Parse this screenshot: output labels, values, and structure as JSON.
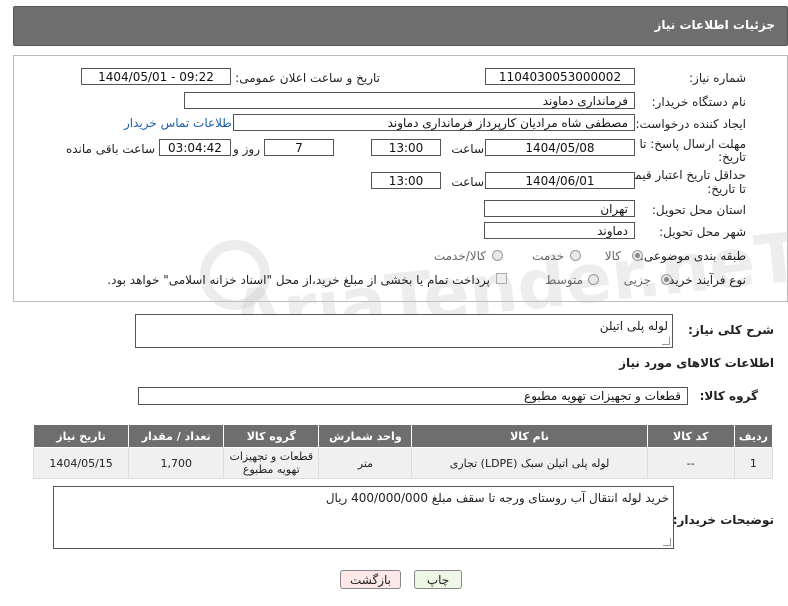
{
  "header": {
    "title": "جزئیات اطلاعات نیاز"
  },
  "form": {
    "need_number_label": "شماره نیاز:",
    "need_number": "1104030053000002",
    "announce_label": "تاریخ و ساعت اعلان عمومی:",
    "announce_value": "1404/05/01 - 09:22",
    "buyer_org_label": "نام دستگاه خریدار:",
    "buyer_org": "فرمانداری دماوند",
    "creator_label": "ایجاد کننده درخواست:",
    "creator": "مصطفی شاه مرادیان کارپرداز فرمانداری دماوند",
    "contact_link": "اطلاعات تماس خریدار",
    "deadline_label_1": "مهلت ارسال پاسخ: تا",
    "deadline_label_2": "تاریخ:",
    "deadline_date": "1404/05/08",
    "time_label": "ساعت",
    "deadline_time": "13:00",
    "days_value": "7",
    "days_label": "روز و",
    "remaining_time": "03:04:42",
    "remaining_label": "ساعت باقی مانده",
    "validity_label_1": "حداقل تاریخ اعتبار قیمت:",
    "validity_label_2": "تا تاریخ:",
    "validity_date": "1404/06/01",
    "validity_time": "13:00",
    "province_label": "استان محل تحویل:",
    "province": "تهران",
    "city_label": "شهر محل تحویل:",
    "city": "دماوند",
    "category_label": "طبقه بندی موضوعی:",
    "category_options": [
      "کالا",
      "خدمت",
      "کالا/خدمت"
    ],
    "category_selected": "کالا",
    "process_label": "نوع فرآیند خرید :",
    "process_options": [
      "جزیی",
      "متوسط"
    ],
    "process_selected": "جزیی",
    "payment_note": "پرداخت تمام یا بخشی از مبلغ خرید،از محل \"اسناد خزانه اسلامی\" خواهد بود."
  },
  "description": {
    "label": "شرح کلی نیاز:",
    "value": "لوله پلی اتیلن"
  },
  "goods_info_title": "اطلاعات کالاهای مورد نیاز",
  "goods_group": {
    "label": "گروه کالا:",
    "value": "قطعات و تجهیزات تهویه مطبوع"
  },
  "table": {
    "headers": [
      "ردیف",
      "کد کالا",
      "نام کالا",
      "واحد شمارش",
      "گروه کالا",
      "تعداد / مقدار",
      "تاریخ نیاز"
    ],
    "rows": [
      [
        "1",
        "--",
        "لوله پلی اتیلن سبک (LDPE) تجاری",
        "متر",
        "قطعات و تجهیزات تهویه مطبوع",
        "1,700",
        "1404/05/15"
      ]
    ]
  },
  "buyer_notes": {
    "label": "توضیحات خریدار:",
    "value": "خرید لوله انتقال آب روستای ورجه تا سقف مبلغ 400/000/000 ریال"
  },
  "buttons": {
    "print": "چاپ",
    "back": "بازگشت"
  },
  "watermark": "AriaTender.neT"
}
